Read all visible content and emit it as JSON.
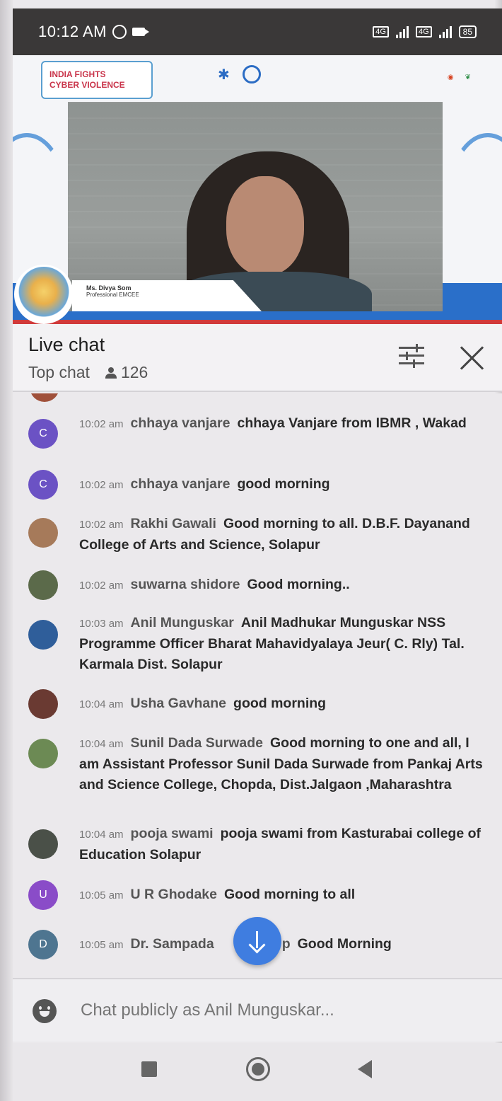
{
  "status_bar": {
    "time": "10:12 AM",
    "sim1": "4G",
    "sim2": "4G",
    "battery": "85"
  },
  "video": {
    "banner_line1": "INDIA FIGHTS",
    "banner_line2": "CYBER VIOLENCE",
    "speaker_name": "Ms. Divya Som",
    "speaker_role": "Professional EMCEE"
  },
  "chat_header": {
    "title": "Live chat",
    "mode": "Top chat",
    "viewer_count": "126"
  },
  "messages": [
    {
      "time": "10:02 am",
      "author": "chhaya vanjare",
      "text": "chhaya Vanjare from IBMR , Wakad",
      "avatar_letter": "C",
      "avatar_color": "#6b52c4"
    },
    {
      "time": "10:02 am",
      "author": "chhaya vanjare",
      "text": "good morning",
      "avatar_letter": "C",
      "avatar_color": "#6b52c4"
    },
    {
      "time": "10:02 am",
      "author": "Rakhi Gawali",
      "text": "Good morning to all. D.B.F. Dayanand College of Arts and Science, Solapur",
      "avatar_letter": "",
      "avatar_color": "#a67a5a"
    },
    {
      "time": "10:02 am",
      "author": "suwarna shidore",
      "text": "Good morning..",
      "avatar_letter": "",
      "avatar_color": "#5b6a4a"
    },
    {
      "time": "10:03 am",
      "author": "Anil Munguskar",
      "text": "Anil Madhukar Munguskar NSS Programme Officer Bharat Mahavidyalaya Jeur( C. Rly) Tal. Karmala Dist. Solapur",
      "avatar_letter": "",
      "avatar_color": "#2f5e9a"
    },
    {
      "time": "10:04 am",
      "author": "Usha Gavhane",
      "text": "good morning",
      "avatar_letter": "",
      "avatar_color": "#6a3a32"
    },
    {
      "time": "10:04 am",
      "author": "Sunil Dada Surwade",
      "text": "Good morning to one and all, I am Assistant Professor Sunil Dada Surwade from Pankaj Arts and Science College, Chopda, Dist.Jalgaon ,Maharashtra",
      "avatar_letter": "",
      "avatar_color": "#6c8a54"
    },
    {
      "time": "10:04 am",
      "author": "pooja swami",
      "text": "pooja swami from Kasturabai college of Education Solapur",
      "avatar_letter": "",
      "avatar_color": "#4a5048"
    },
    {
      "time": "10:05 am",
      "author": "U R Ghodake",
      "text": "Good morning to all",
      "avatar_letter": "U",
      "avatar_color": "#8a4cc8"
    },
    {
      "time": "10:05 am",
      "author": "Dr. Sampada",
      "author_suffix": "p",
      "text": "Good Morning",
      "avatar_letter": "D",
      "avatar_color": "#4e7590"
    }
  ],
  "chat_input": {
    "placeholder": "Chat publicly as Anil Munguskar..."
  }
}
